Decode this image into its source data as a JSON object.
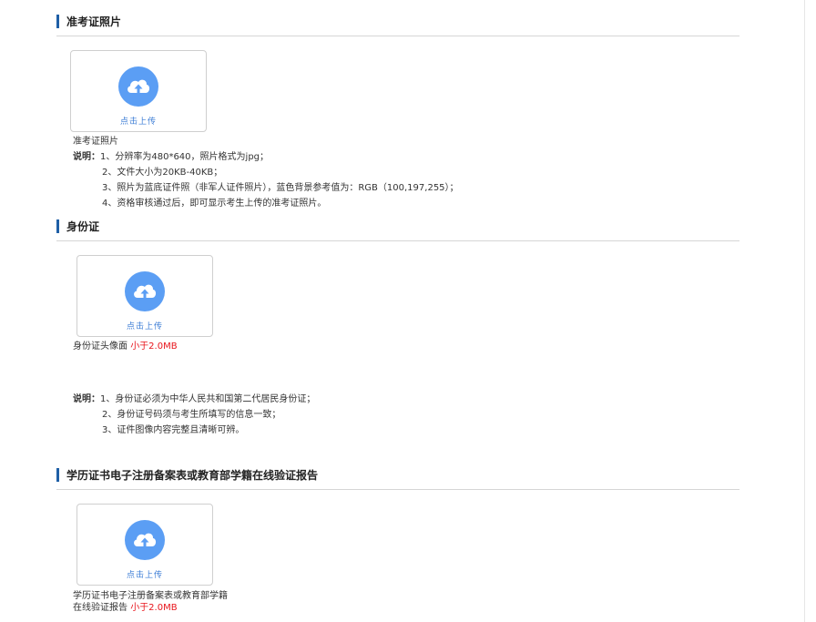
{
  "upload_button_label": "点击上传",
  "sections": [
    {
      "title": "准考证照片",
      "caption": "准考证照片",
      "note_label": "说明：",
      "notes": [
        "1、分辨率为480*640，照片格式为jpg；",
        "2、文件大小为20KB-40KB；",
        "3、照片为蓝底证件照（非军人证件照片），蓝色背景参考值为：RGB（100,197,255）；",
        "4、资格审核通过后，即可显示考生上传的准考证照片。"
      ]
    },
    {
      "title": "身份证",
      "caption": "身份证头像面",
      "size_limit": "小于2.0MB",
      "note_label": "说明：",
      "notes": [
        "1、身份证必须为中华人民共和国第二代居民身份证；",
        "2、身份证号码须与考生所填写的信息一致；",
        "3、证件图像内容完整且清晰可辨。"
      ]
    },
    {
      "title": "学历证书电子注册备案表或教育部学籍在线验证报告",
      "caption_line1": "学历证书电子注册备案表或教育部学籍",
      "caption_line2": "在线验证报告",
      "size_limit": "小于2.0MB"
    }
  ],
  "colors": {
    "accent_bar": "#1f5fa6",
    "upload_icon": "#5b9ef4",
    "size_limit": "#e8141b"
  }
}
